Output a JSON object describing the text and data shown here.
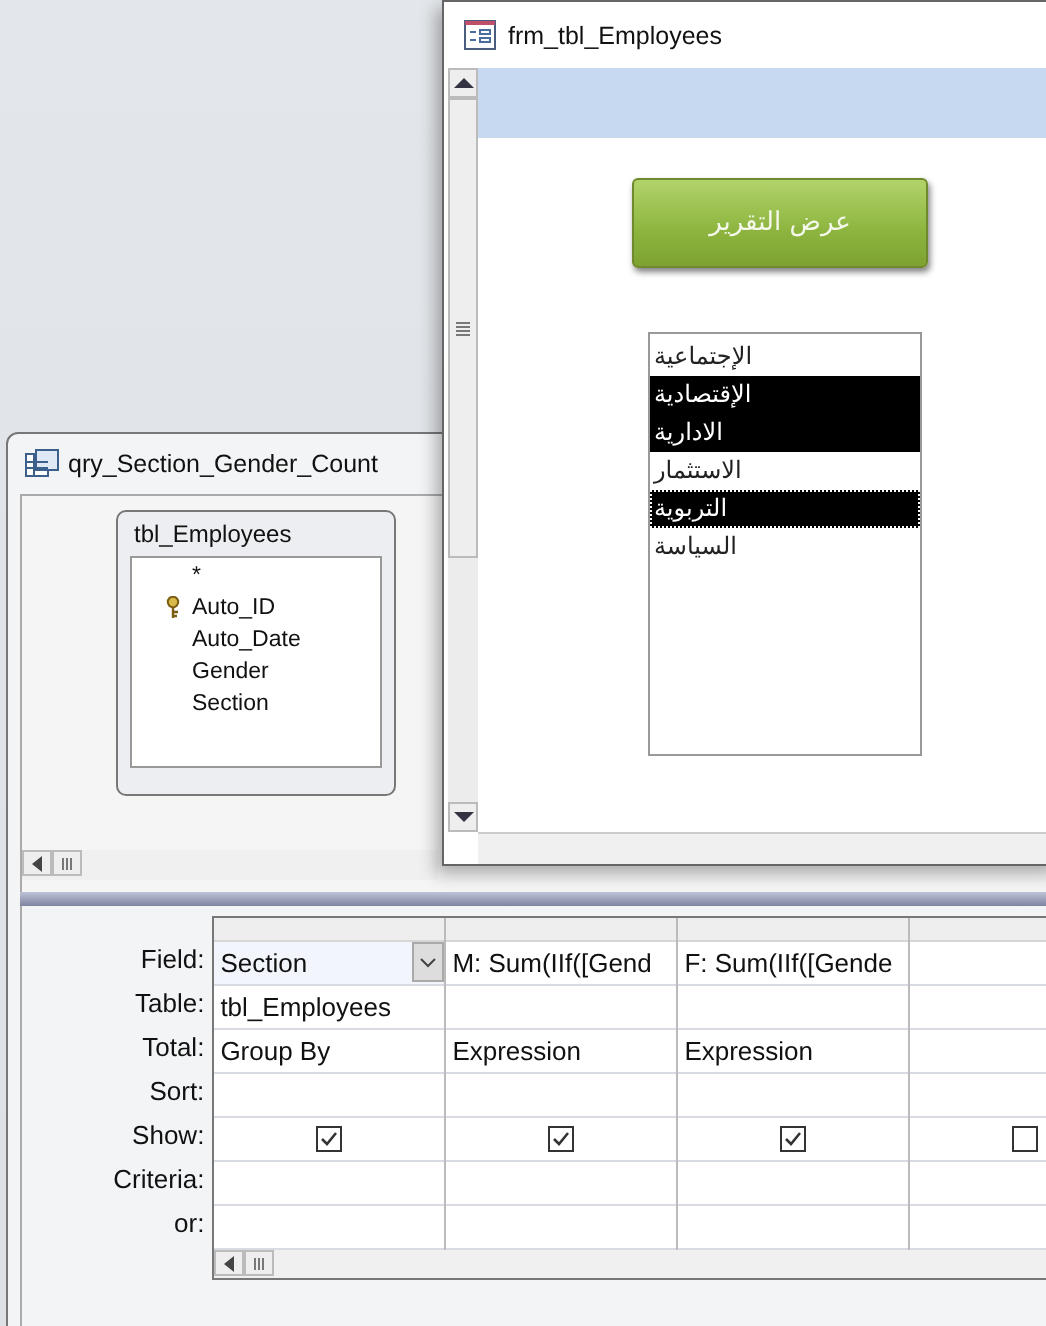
{
  "query_window": {
    "title": "qry_Section_Gender_Count",
    "table": {
      "name": "tbl_Employees",
      "fields": [
        {
          "name": "*",
          "primary_key": false
        },
        {
          "name": "Auto_ID",
          "primary_key": true
        },
        {
          "name": "Auto_Date",
          "primary_key": false
        },
        {
          "name": "Gender",
          "primary_key": false
        },
        {
          "name": "Section",
          "primary_key": false
        }
      ]
    },
    "grid": {
      "rows": [
        {
          "label": "Field:",
          "kind": "text"
        },
        {
          "label": "Table:",
          "kind": "text"
        },
        {
          "label": "Total:",
          "kind": "text"
        },
        {
          "label": "Sort:",
          "kind": "text"
        },
        {
          "label": "Show:",
          "kind": "check"
        },
        {
          "label": "Criteria:",
          "kind": "text"
        },
        {
          "label": "or:",
          "kind": "text"
        }
      ],
      "columns": [
        {
          "selected": true,
          "cells": {
            "field": "Section",
            "table": "tbl_Employees",
            "total": "Group By",
            "show": true
          }
        },
        {
          "selected": false,
          "cells": {
            "field": "M: Sum(IIf([Gend",
            "total": "Expression",
            "show": true
          }
        },
        {
          "selected": false,
          "cells": {
            "field": "F: Sum(IIf([Gende",
            "total": "Expression",
            "show": true
          }
        },
        {
          "selected": false,
          "cells": {
            "show": false
          }
        }
      ]
    }
  },
  "form_window": {
    "title": "frm_tbl_Employees",
    "button": "عرض التقرير",
    "list_items": [
      {
        "label": "الإجتماعية",
        "selected": false,
        "focused": false
      },
      {
        "label": "الإقتصادية",
        "selected": true,
        "focused": false
      },
      {
        "label": "الادارية",
        "selected": true,
        "focused": false
      },
      {
        "label": "الاستثمار",
        "selected": false,
        "focused": false
      },
      {
        "label": "التربوية",
        "selected": true,
        "focused": true
      },
      {
        "label": "السياسة",
        "selected": false,
        "focused": false
      }
    ]
  }
}
